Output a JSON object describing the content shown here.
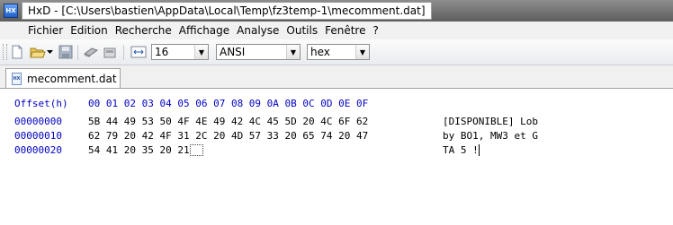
{
  "titlebar": {
    "icon_text": "HX",
    "title": "HxD - [C:\\Users\\bastien\\AppData\\Local\\Temp\\fz3temp-1\\mecomment.dat]"
  },
  "menu": [
    "Fichier",
    "Edition",
    "Recherche",
    "Affichage",
    "Analyse",
    "Outils",
    "Fenêtre",
    "?"
  ],
  "toolbar": {
    "bytes_per_row": "16",
    "charset": "ANSI",
    "offset_base": "hex"
  },
  "tab": {
    "icon_text": "HX",
    "label": "mecomment.dat"
  },
  "hex": {
    "header_label": "Offset(h)",
    "columns": "00 01 02 03 04 05 06 07 08 09 0A 0B 0C 0D 0E 0F",
    "rows": [
      {
        "offset": "00000000",
        "bytes": "5B 44 49 53 50 4F 4E 49 42 4C 45 5D 20 4C 6F 62",
        "bytes_tail": "",
        "text": "[DISPONIBLE] Lob",
        "text_tail": ""
      },
      {
        "offset": "00000010",
        "bytes": "62 79 20 42 4F 31 2C 20 4D 57 33 20 65 74 20 47",
        "bytes_tail": "",
        "text": "by BO1, MW3 et G",
        "text_tail": ""
      },
      {
        "offset": "00000020",
        "bytes": "54 41 20 35 20 21",
        "bytes_tail": "",
        "text": "TA 5 !",
        "text_tail": ""
      }
    ]
  },
  "colors": {
    "offset_blue": "#0000c0",
    "titlebar": "#6e6e6e"
  },
  "icons": [
    "new-file-icon",
    "open-folder-icon",
    "save-icon",
    "ram-icon",
    "disk-icon",
    "row-width-icon",
    "dropdown-arrow-icon"
  ]
}
